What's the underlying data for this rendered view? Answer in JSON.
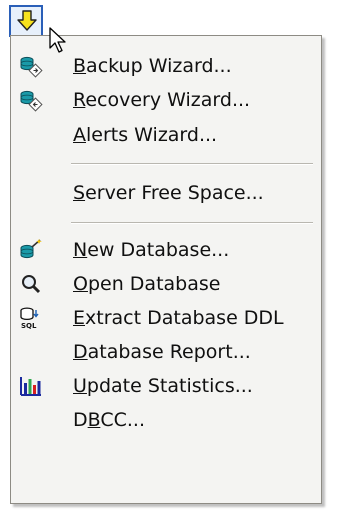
{
  "toolbar": {
    "button_icon": "down-arrow-icon",
    "button_color": "#f7e21d"
  },
  "menu": {
    "items": [
      {
        "label": "Backup Wizard...",
        "accel": "B",
        "icon": "backup-database-icon"
      },
      {
        "label": "Recovery Wizard...",
        "accel": "R",
        "icon": "recovery-database-icon"
      },
      {
        "label": "Alerts Wizard...",
        "accel": "A",
        "icon": ""
      },
      {
        "label": "Server Free Space...",
        "accel": "S",
        "icon": ""
      },
      {
        "label": "New Database...",
        "accel": "N",
        "icon": "new-database-icon"
      },
      {
        "label": "Open Database",
        "accel": "O",
        "icon": "magnifier-icon"
      },
      {
        "label": "Extract Database DDL",
        "accel": "E",
        "icon": "sql-database-icon"
      },
      {
        "label": "Database Report...",
        "accel": "D",
        "icon": ""
      },
      {
        "label": "Update Statistics...",
        "accel": "U",
        "icon": "bar-chart-icon"
      },
      {
        "label": "DBCC...",
        "accel": "B",
        "icon": ""
      }
    ]
  },
  "colors": {
    "menu_bg": "#f4f4f2",
    "menu_border": "#8d8b84",
    "toolbar_border": "#2a5fb8"
  }
}
